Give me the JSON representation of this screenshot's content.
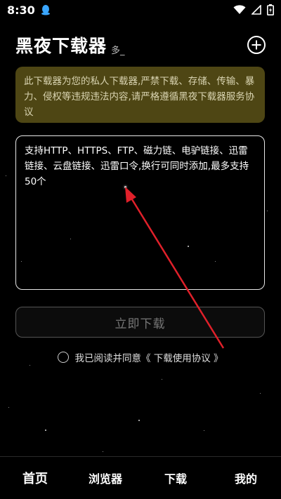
{
  "status_bar": {
    "time": "8:30",
    "notification_icon": "qq-penguin-icon",
    "wifi_icon": "wifi-icon",
    "signal_icon": "cell-signal-icon",
    "battery_icon": "battery-charging-icon"
  },
  "header": {
    "title": "黑夜下载器",
    "title_suffix": "多_",
    "add_icon": "plus-circle-icon"
  },
  "notice": {
    "text": "此下载器为您的私人下载器,严禁下载、存储、传输、暴力、侵权等违规违法内容,请严格遵循黑夜下载器服务协议",
    "background_color": "#4e4614"
  },
  "url_input": {
    "placeholder": "支持HTTP、HTTPS、FTP、磁力链、电驴链接、迅雷链接、云盘链接、迅雷口令,换行可同时添加,最多支持50个",
    "value": ""
  },
  "download_button": {
    "label": "立即下载"
  },
  "agreement": {
    "text": "我已阅读并同意",
    "link_text": "《 下载使用协议 》",
    "checked": false
  },
  "bottom_nav": {
    "items": [
      {
        "label": "首页",
        "active": true
      },
      {
        "label": "浏览器",
        "active": false
      },
      {
        "label": "下载",
        "active": false
      },
      {
        "label": "我的",
        "active": false
      }
    ]
  },
  "annotation": {
    "arrow_color": "#e0202a"
  }
}
